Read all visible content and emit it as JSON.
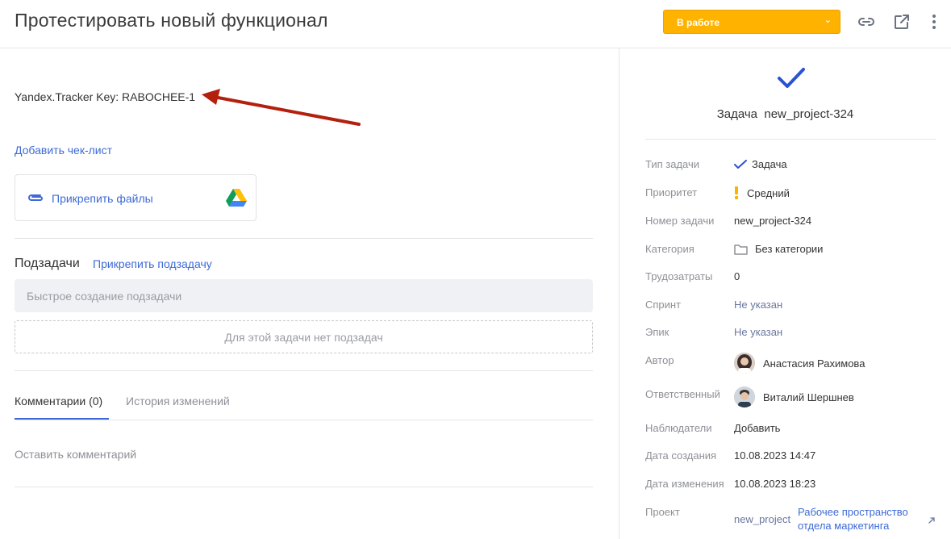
{
  "header": {
    "title": "Протестировать новый функционал",
    "status_label": "В работе",
    "status_color": "#ffb300",
    "icons": [
      "link-icon",
      "external-link-icon",
      "more-vertical-icon"
    ]
  },
  "main": {
    "key_text": "Yandex.Tracker Key: RABOCHEE-1",
    "annotation_color": "#b3200e",
    "add_checklist": "Добавить чек-лист",
    "attach_files": "Прикрепить файлы",
    "subtasks": {
      "title": "Подзадачи",
      "attach_link": "Прикрепить подзадачу",
      "quick_create_placeholder": "Быстрое создание подзадачи",
      "empty_text": "Для этой задачи нет подзадач"
    },
    "tabs": [
      {
        "label": "Комментарии (0)",
        "active": true
      },
      {
        "label": "История изменений",
        "active": false
      }
    ],
    "leave_comment": "Оставить комментарий"
  },
  "sidebar": {
    "task_type_word": "Задача",
    "task_key": "new_project-324",
    "props": {
      "type": {
        "label": "Тип задачи",
        "value": "Задача"
      },
      "priority": {
        "label": "Приоритет",
        "value": "Средний"
      },
      "number": {
        "label": "Номер задачи",
        "value": "new_project-324"
      },
      "category": {
        "label": "Категория",
        "value": "Без категории"
      },
      "effort": {
        "label": "Трудозатраты",
        "value": "0"
      },
      "sprint": {
        "label": "Спринт",
        "value": "Не указан"
      },
      "epic": {
        "label": "Эпик",
        "value": "Не указан"
      },
      "author": {
        "label": "Автор",
        "value": "Анастасия Рахимова"
      },
      "assignee": {
        "label": "Ответственный",
        "value": "Виталий Шершнев"
      },
      "watchers": {
        "label": "Наблюдатели",
        "value": "Добавить"
      },
      "created": {
        "label": "Дата создания",
        "value": "10.08.2023 14:47"
      },
      "modified": {
        "label": "Дата изменения",
        "value": "10.08.2023 18:23"
      },
      "project": {
        "label": "Проект",
        "value": "new_project",
        "workspace": "Рабочее пространство отдела маркетинга"
      }
    }
  }
}
